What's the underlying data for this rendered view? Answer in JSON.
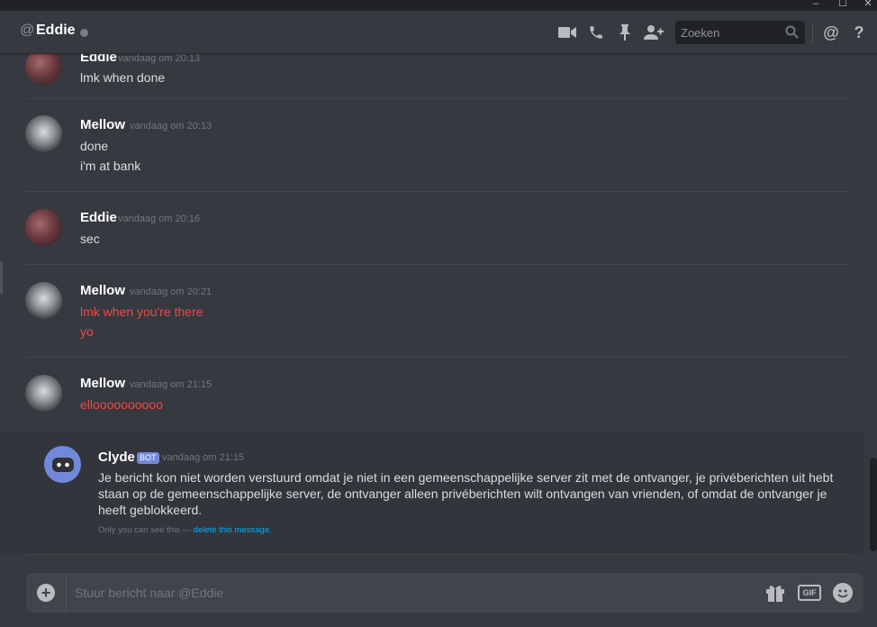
{
  "window": {
    "min_glyph": "–",
    "max_glyph": "☐",
    "close_glyph": "✕"
  },
  "header": {
    "at_symbol": "@",
    "channel_name": "Eddie",
    "search_placeholder": "Zoeken",
    "mention_glyph": "@",
    "help_glyph": "?",
    "icons": [
      "video-call-icon",
      "voice-call-icon",
      "pin-icon",
      "add-friend-icon",
      "search-icon",
      "mentions-icon",
      "help-icon"
    ]
  },
  "messages": [
    {
      "author": "Eddie",
      "timestamp": "vandaag om 20:13",
      "lines": [
        "lmk when done"
      ],
      "failed": false
    },
    {
      "author": "Mellow",
      "timestamp": "vandaag om 20:13",
      "lines": [
        "done",
        "i'm at bank"
      ],
      "failed": false
    },
    {
      "author": "Eddie",
      "timestamp": "vandaag om 20:16",
      "lines": [
        "sec"
      ],
      "failed": false
    },
    {
      "author": "Mellow",
      "timestamp": "vandaag om 20:21",
      "lines": [
        "lmk when you're there",
        "yo"
      ],
      "failed": true
    },
    {
      "author": "Mellow",
      "timestamp": "vandaag om 21:15",
      "lines": [
        "elloooooooooo"
      ],
      "failed": true
    }
  ],
  "clyde": {
    "author": "Clyde",
    "badge": "BOT",
    "timestamp": "vandaag om 21:15",
    "text": "Je bericht kon niet worden verstuurd omdat je niet in een gemeenschappelijke server zit met de ontvanger, je privéberichten uit hebt staan op de gemeenschappelijke server, de ontvanger alleen privéberichten wilt ontvangen van vrienden, of omdat de ontvanger je heeft geblokkeerd.",
    "note_prefix": "Only you can see this —",
    "note_link": "delete this message."
  },
  "composer": {
    "plus_glyph": "+",
    "placeholder": "Stuur bericht naar @Eddie",
    "gif_label": "GIF"
  },
  "colors": {
    "background": "#36393f",
    "failed_text": "#f04747",
    "link": "#00b0f4",
    "bot_badge": "#7289da"
  }
}
